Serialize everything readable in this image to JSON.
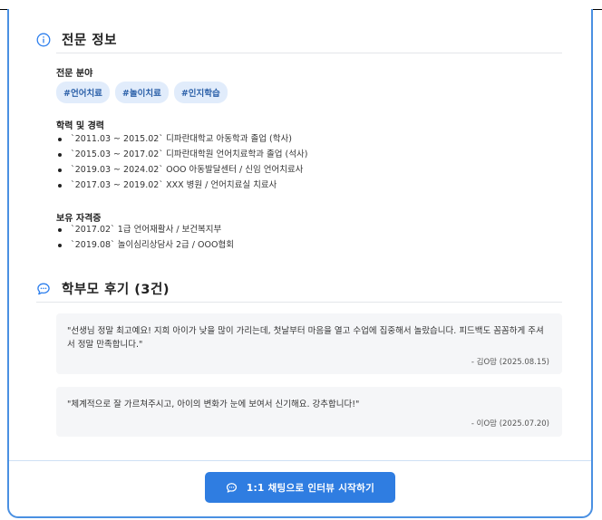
{
  "expertise": {
    "title": "전문 정보",
    "icon": "info-icon",
    "field_label": "전문 분야",
    "tags": [
      "#언어치료",
      "#놀이치료",
      "#인지학습"
    ],
    "career_label": "학력 및 경력",
    "career": [
      "`2011.03 ~ 2015.02` 디파란대학교 아동학과 졸업 (학사)",
      "`2015.03 ~ 2017.02` 디파란대학원 언어치료학과 졸업 (석사)",
      "`2019.03 ~ 2024.02` OOO 아동발달센터 / 신임 언어치료사",
      "`2017.03 ~ 2019.02` XXX 병원 / 언어치료실 치료사"
    ],
    "cert_label": "보유 자격증",
    "certs": [
      "`2017.02` 1급 언어재활사 / 보건복지부",
      "`2019.08` 놀이심리상담사 2급 / OOO협회"
    ]
  },
  "reviews": {
    "title": "학부모 후기 (3건)",
    "icon": "chat-bubble-icon",
    "items": [
      {
        "text": "\"선생님 정말 최고예요! 지희 아이가 낮을 많이 가리는데, 첫날부터 마음을 열고 수업에 집중해서 놀랐습니다. 피드백도 꼼꼼하게 주셔서 정말 만족합니다.\"",
        "author": "- 김O맘 (2025.08.15)"
      },
      {
        "text": "\"체계적으로 잘 가르쳐주시고, 아이의 변화가 눈에 보여서 신기해요. 강추합니다!\"",
        "author": "- 이O맘 (2025.07.20)"
      }
    ]
  },
  "cta": {
    "label": "1:1 채팅으로 인터뷰 시작하기",
    "icon": "chat-bubble-icon"
  },
  "colors": {
    "accent": "#2f7de1",
    "tag_bg": "#e1ecfb",
    "review_bg": "#f5f6f8"
  }
}
